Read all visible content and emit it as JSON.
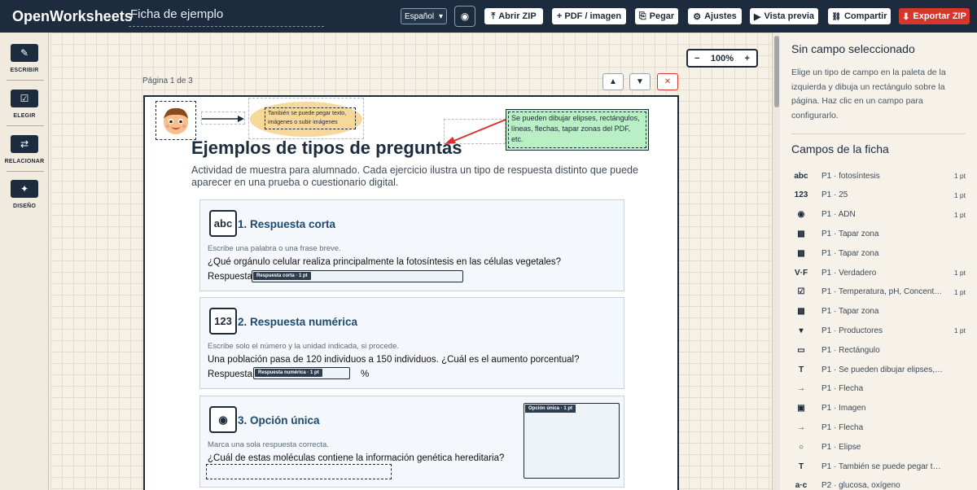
{
  "app": {
    "brand": "OpenWorksheets",
    "doc_title": "Ficha de ejemplo",
    "language": "Español"
  },
  "toolbar": [
    {
      "label": "Abrir ZIP",
      "icon": "⤒"
    },
    {
      "label": "+ PDF / imagen",
      "icon": ""
    },
    {
      "label": "Pegar",
      "icon": "⎘"
    },
    {
      "label": "Ajustes",
      "icon": "⚙"
    },
    {
      "label": "Vista previa",
      "icon": "▶"
    },
    {
      "label": "Compartir",
      "icon": "🔗"
    },
    {
      "label": "Exportar ZIP",
      "icon": "⬇"
    }
  ],
  "palette": [
    {
      "label": "ESCRIBIR",
      "icon": "✎"
    },
    {
      "label": "ELEGIR",
      "icon": "☑"
    },
    {
      "label": "RELACIONAR",
      "icon": "⇄"
    },
    {
      "label": "DISEÑO",
      "icon": "✦"
    }
  ],
  "canvas": {
    "zoom": "100%",
    "page_label": "Página 1 de 3",
    "ellipse_text": "También se puede pegar texto, imágenes o subir imágenes",
    "note_text": "Se pueden dibujar elipses, rectángulos, líneas, flechas, tapar zonas del PDF, etc.",
    "title": "Ejemplos de tipos de preguntas",
    "subtitle": "Actividad de muestra para alumnado. Cada ejercicio ilustra un tipo de respuesta distinto que puede aparecer en una prueba o cuestionario digital.",
    "questions": [
      {
        "icon": "abc",
        "title": "1. Respuesta corta",
        "hint": "Escribe una palabra o una frase breve.",
        "text": "¿Qué orgánulo celular realiza principalmente la fotosíntesis en las células vegetales?",
        "answer_label": "Respuesta:",
        "field_tag": "Respuesta corta · 1 pt"
      },
      {
        "icon": "123",
        "title": "2. Respuesta numérica",
        "hint": "Escribe solo el número y la unidad indicada, si procede.",
        "text": "Una población pasa de 120 individuos a 150 individuos. ¿Cuál es el aumento porcentual?",
        "answer_label": "Respuesta:",
        "field_tag": "Respuesta numérica · 1 pt",
        "unit": "%"
      },
      {
        "icon": "◉",
        "title": "3. Opción única",
        "hint": "Marca una sola respuesta correcta.",
        "text": "¿Cuál de estas moléculas contiene la información genética hereditaria?",
        "field_tag": "Opción única · 1 pt"
      }
    ]
  },
  "panel": {
    "heading": "Sin campo seleccionado",
    "help": "Elige un tipo de campo en la paleta de la izquierda y dibuja un rectángulo sobre la página. Haz clic en un campo para configurarlo.",
    "fields_heading": "Campos de la ficha",
    "fields": [
      {
        "icon": "abc",
        "name": "P1 · fotosíntesis",
        "pts": "1 pt"
      },
      {
        "icon": "123",
        "name": "P1 · 25",
        "pts": "1 pt"
      },
      {
        "icon": "◉",
        "name": "P1 · ADN",
        "pts": "1 pt"
      },
      {
        "icon": "▩",
        "name": "P1 · Tapar zona",
        "pts": ""
      },
      {
        "icon": "▩",
        "name": "P1 · Tapar zona",
        "pts": ""
      },
      {
        "icon": "V·F",
        "name": "P1 · Verdadero",
        "pts": "1 pt"
      },
      {
        "icon": "☑",
        "name": "P1 · Temperatura, pH, Concentr…",
        "pts": "1 pt"
      },
      {
        "icon": "▩",
        "name": "P1 · Tapar zona",
        "pts": ""
      },
      {
        "icon": "▾",
        "name": "P1 · Productores",
        "pts": "1 pt"
      },
      {
        "icon": "▭",
        "name": "P1 · Rectángulo",
        "pts": ""
      },
      {
        "icon": "T",
        "name": "P1 · Se pueden dibujar elipses, rect…",
        "pts": ""
      },
      {
        "icon": "→",
        "name": "P1 · Flecha",
        "pts": ""
      },
      {
        "icon": "▣",
        "name": "P1 · Imagen",
        "pts": ""
      },
      {
        "icon": "→",
        "name": "P1 · Flecha",
        "pts": ""
      },
      {
        "icon": "○",
        "name": "P1 · Elipse",
        "pts": ""
      },
      {
        "icon": "T",
        "name": "P1 · También se puede pegar texto,…",
        "pts": ""
      },
      {
        "icon": "a·c",
        "name": "P2 · glucosa, oxígeno",
        "pts": ""
      }
    ]
  }
}
